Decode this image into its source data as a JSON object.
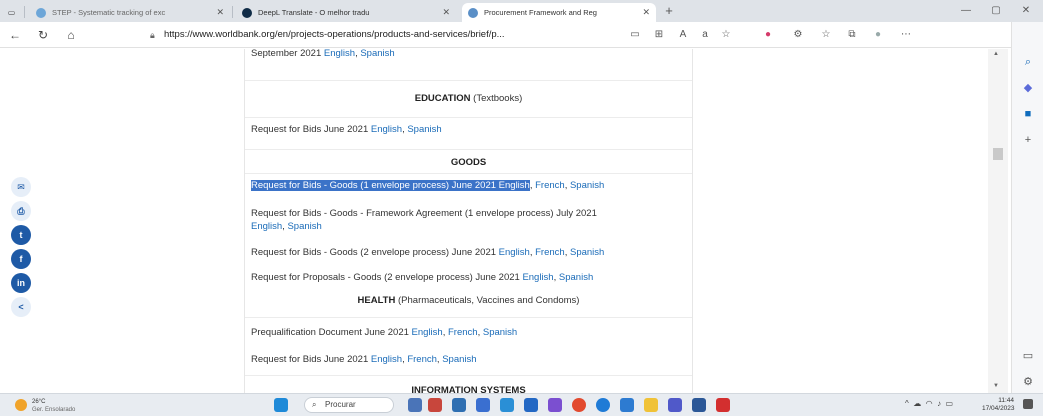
{
  "browser": {
    "tabs": [
      {
        "title": "STEP - Systematic tracking of exc",
        "active": false
      },
      {
        "title": "DeepL Translate - O melhor tradu",
        "active": false
      },
      {
        "title": "Procurement Framework and Reg",
        "active": true
      }
    ],
    "new_tab": "+",
    "url": "https://www.worldbank.org/en/projects-operations/products-and-services/brief/p..."
  },
  "page": {
    "top_line": {
      "text": "September 2021 ",
      "links": [
        "English",
        "Spanish"
      ]
    },
    "education": {
      "heading": "EDUCATION",
      "sub": " (Textbooks)"
    },
    "edu_rfb": {
      "text": "Request for Bids June 2021 ",
      "links": [
        "English",
        "Spanish"
      ]
    },
    "goods_heading": "GOODS",
    "goods": [
      {
        "text": "Request for Bids - Goods (1 envelope process) June 2021 English",
        "links": [
          "French",
          "Spanish"
        ],
        "highlighted": true
      },
      {
        "text": "Request for Bids - Goods - Framework Agreement (1 envelope process) July 2021",
        "links": [
          "English",
          "Spanish"
        ]
      },
      {
        "text": "Request for Bids - Goods (2 envelope process) June 2021 ",
        "links": [
          "English",
          "French",
          "Spanish"
        ]
      },
      {
        "text": "Request for Proposals - Goods (2 envelope process) June 2021 ",
        "links": [
          "English",
          "Spanish"
        ]
      }
    ],
    "health": {
      "heading": "HEALTH",
      "sub": " (Pharmaceuticals, Vaccines and Condoms)"
    },
    "health_items": [
      {
        "text": "Prequalification Document June 2021 ",
        "links": [
          "English",
          "French",
          "Spanish"
        ]
      },
      {
        "text": "Request for Bids June 2021 ",
        "links": [
          "English",
          "French",
          "Spanish"
        ]
      }
    ],
    "info_heading": "INFORMATION SYSTEMS"
  },
  "taskbar": {
    "weather_temp": "26°C",
    "weather_desc": "Ger. Ensolarado",
    "search_placeholder": "Procurar",
    "time": "11:44",
    "date": "17/04/2023"
  },
  "colors": {
    "link": "#1a6bb8",
    "highlight": "#3b73c8",
    "social_dark": "#1e5aa6"
  },
  "icons": [
    "mail-icon",
    "print-icon",
    "twitter-icon",
    "facebook-icon",
    "linkedin-icon",
    "share-icon"
  ]
}
